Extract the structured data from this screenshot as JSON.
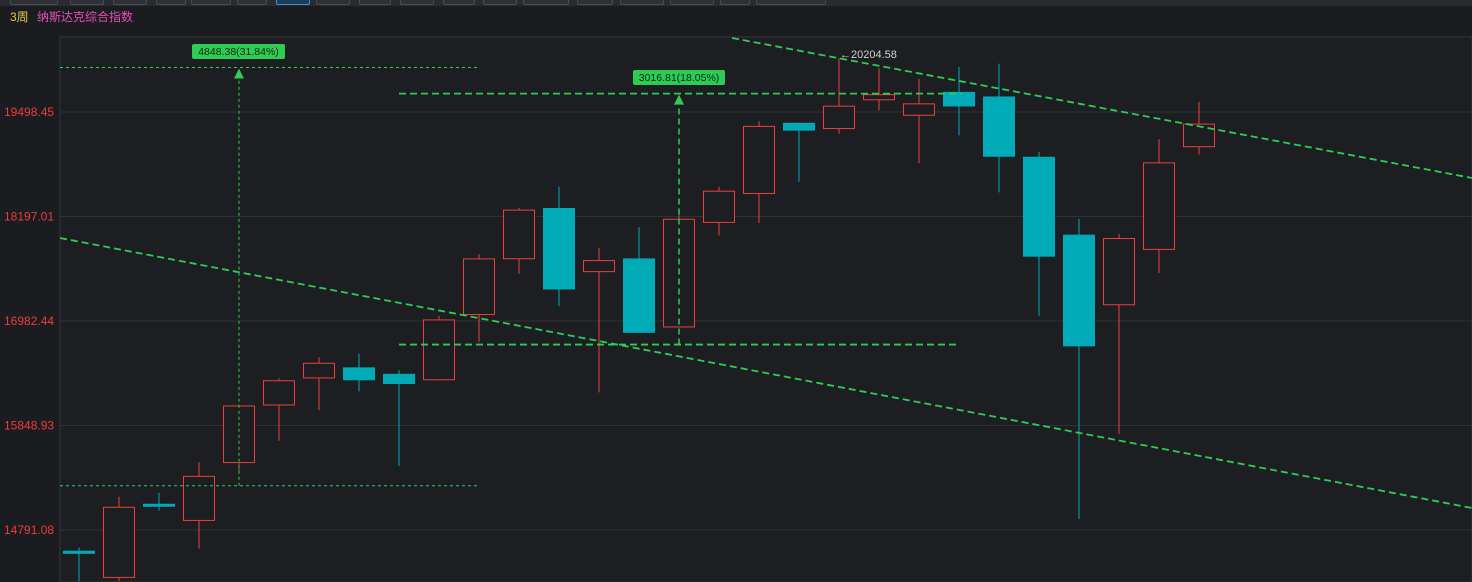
{
  "toolbar": {
    "buttons": [
      "",
      "",
      "",
      "",
      "",
      "",
      "",
      "",
      "",
      "",
      "",
      "",
      "",
      "",
      "",
      "",
      "",
      "",
      ""
    ],
    "active_index": 6
  },
  "header": {
    "period": "3周",
    "index_name": "纳斯达克综合指数"
  },
  "colors": {
    "up": "#e8403c",
    "down": "#00aab7",
    "drawing": "#2ecc55",
    "price_label": "#ee3b3b"
  },
  "chart_data": {
    "type": "candlestick",
    "y_ticks": [
      "19498.45",
      "18197.01",
      "16982.44",
      "15848.93",
      "14791.08"
    ],
    "y_tick_values": [
      19498.45,
      18197.01,
      16982.44,
      15848.93,
      14791.08
    ],
    "ylim": [
      14300,
      20840
    ],
    "y_scale": "log",
    "candles": [
      {
        "open": 14590,
        "high": 14620,
        "low": 14300,
        "close": 14560
      },
      {
        "open": 14330,
        "high": 15120,
        "low": 14300,
        "close": 15020
      },
      {
        "open": 15050,
        "high": 15160,
        "low": 14980,
        "close": 15020
      },
      {
        "open": 14880,
        "high": 15470,
        "low": 14610,
        "close": 15330
      },
      {
        "open": 15460,
        "high": 16070,
        "low": 15360,
        "close": 16060
      },
      {
        "open": 16060,
        "high": 16350,
        "low": 15690,
        "close": 16330
      },
      {
        "open": 16350,
        "high": 16580,
        "low": 16010,
        "close": 16520
      },
      {
        "open": 16470,
        "high": 16620,
        "low": 16210,
        "close": 16330
      },
      {
        "open": 16400,
        "high": 16440,
        "low": 15430,
        "close": 16290
      },
      {
        "open": 16330,
        "high": 17040,
        "low": 16330,
        "close": 17000
      },
      {
        "open": 17050,
        "high": 17750,
        "low": 16750,
        "close": 17700
      },
      {
        "open": 17690,
        "high": 18300,
        "low": 17520,
        "close": 18280
      },
      {
        "open": 18300,
        "high": 18560,
        "low": 17150,
        "close": 17340
      },
      {
        "open": 17540,
        "high": 17820,
        "low": 16200,
        "close": 17680
      },
      {
        "open": 17700,
        "high": 18070,
        "low": 16850,
        "close": 16850
      },
      {
        "open": 16910,
        "high": 18230,
        "low": 16910,
        "close": 18170
      },
      {
        "open": 18120,
        "high": 18560,
        "low": 17970,
        "close": 18510
      },
      {
        "open": 18470,
        "high": 19380,
        "low": 18120,
        "close": 19320
      },
      {
        "open": 19360,
        "high": 19360,
        "low": 18620,
        "close": 19260
      },
      {
        "open": 19280,
        "high": 20204.58,
        "low": 19220,
        "close": 19580
      },
      {
        "open": 19650,
        "high": 20070,
        "low": 19520,
        "close": 19730
      },
      {
        "open": 19450,
        "high": 19930,
        "low": 18850,
        "close": 19610
      },
      {
        "open": 19760,
        "high": 20090,
        "low": 19200,
        "close": 19570
      },
      {
        "open": 19700,
        "high": 20130,
        "low": 18490,
        "close": 18930
      },
      {
        "open": 18930,
        "high": 18990,
        "low": 17040,
        "close": 17720
      },
      {
        "open": 17980,
        "high": 18170,
        "low": 14900,
        "close": 16700
      },
      {
        "open": 17160,
        "high": 17990,
        "low": 15760,
        "close": 17940
      },
      {
        "open": 17800,
        "high": 19150,
        "low": 17530,
        "close": 18860
      },
      {
        "open": 19050,
        "high": 19630,
        "low": 18960,
        "close": 19350
      }
    ],
    "annotations": {
      "high_label": "←20204.58",
      "measure1": {
        "label": "4848.38(31.84%)",
        "from": 15230,
        "to": 20080
      },
      "measure2": {
        "label": "3016.81(18.05%)",
        "from": 16720,
        "to": 19737
      }
    }
  }
}
